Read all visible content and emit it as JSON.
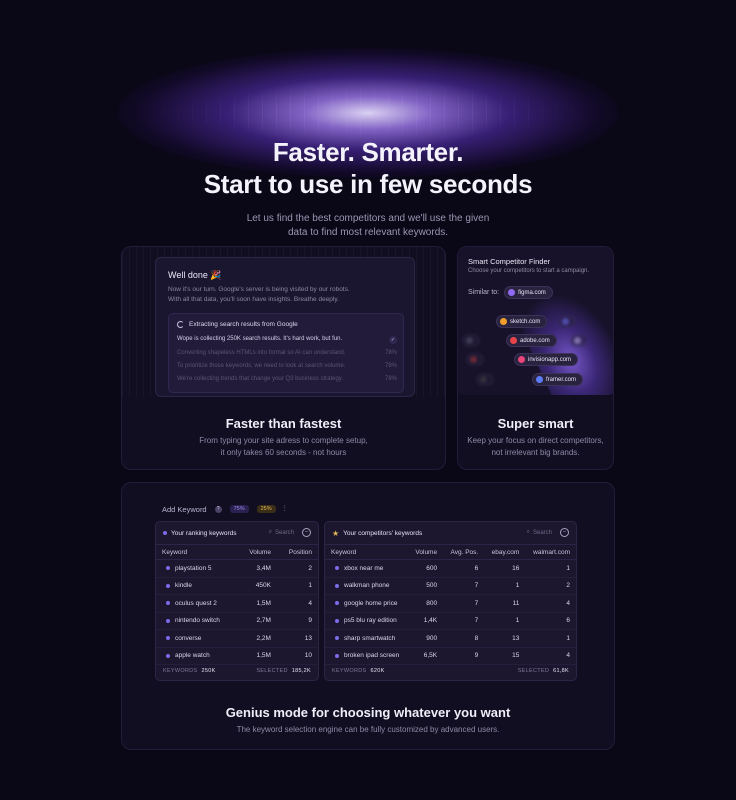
{
  "hero": {
    "title_line1": "Faster. Smarter.",
    "title_line2": "Start to use in few seconds",
    "subtitle_line1": "Let us find the best competitors and we'll use the given",
    "subtitle_line2": "data to find most relevant keywords."
  },
  "fast_card": {
    "title": "Faster than fastest",
    "desc_line1": "From typing your site adress to complete setup,",
    "desc_line2": "it only takes 60 seconds - not hours",
    "panel": {
      "heading": "Well done 🎉",
      "sub_line1": "Now it's our turn. Google's server is being visited by our robots.",
      "sub_line2": "With all that data, you'll soon have insights. Breathe deeply.",
      "task_title": "Extracting search results from Google",
      "tasks": [
        {
          "text": "Wope is collecting 250K search results. It's hard work, but fun.",
          "status": "✓"
        },
        {
          "text": "Converting shapeless HTMLs into format so AI can understand.",
          "status": "78%"
        },
        {
          "text": "To prioritize those keywords, we need to look at search volume.",
          "status": "78%"
        },
        {
          "text": "We're collecting trends that change your Q3 business strategy.",
          "status": "78%"
        }
      ]
    }
  },
  "smart_card": {
    "title": "Super smart",
    "desc_line1": "Keep your focus on direct competitors,",
    "desc_line2": "not irrelevant big brands.",
    "panel": {
      "heading": "Smart Competitor Finder",
      "sub": "Choose your competitors to start a campaign.",
      "similar_label": "Similar to:",
      "similar_value": "figma.com",
      "competitors": [
        "sketch.com",
        "adobe.com",
        "invisionapp.com",
        "framer.com"
      ],
      "colors": {
        "figma": "#8f6bf5",
        "sketch": "#f0a02a",
        "adobe": "#e8454a",
        "invision": "#e8457a",
        "framer": "#5b7cf5"
      }
    }
  },
  "genius_card": {
    "title": "Genius mode for choosing whatever you want",
    "desc": "The keyword selection engine can be fully customized by advanced users.",
    "toolbar": {
      "label": "Add Keyword",
      "tag1": "75%",
      "tag2": "25%"
    },
    "left_panel": {
      "title": "Your ranking keywords",
      "search_placeholder": "Search",
      "columns": [
        "Keyword",
        "Volume",
        "Position"
      ],
      "rows": [
        [
          "playstation 5",
          "3,4M",
          "2"
        ],
        [
          "kindle",
          "450K",
          "1"
        ],
        [
          "oculus quest 2",
          "1,5M",
          "4"
        ],
        [
          "nintendo switch",
          "2,7M",
          "9"
        ],
        [
          "converse",
          "2,2M",
          "13"
        ],
        [
          "apple watch",
          "1,5M",
          "10"
        ]
      ],
      "footer_keywords_label": "KEYWORDS",
      "footer_keywords_value": "250K",
      "footer_selected_label": "SELECTED",
      "footer_selected_value": "185,2K"
    },
    "right_panel": {
      "title": "Your competitors' keywords",
      "search_placeholder": "Search",
      "columns": [
        "Keyword",
        "Volume",
        "Avg. Pos.",
        "ebay.com",
        "walmart.com"
      ],
      "rows": [
        [
          "xbox near me",
          "600",
          "6",
          "16",
          "1"
        ],
        [
          "walkman phone",
          "500",
          "7",
          "1",
          "2"
        ],
        [
          "google home price",
          "800",
          "7",
          "11",
          "4"
        ],
        [
          "ps5 blu ray edition",
          "1,4K",
          "7",
          "1",
          "6"
        ],
        [
          "sharp smartwatch",
          "900",
          "8",
          "13",
          "1"
        ],
        [
          "broken ipad screen",
          "6,5K",
          "9",
          "15",
          "4"
        ]
      ],
      "footer_keywords_label": "KEYWORDS",
      "footer_keywords_value": "620K",
      "footer_selected_label": "SELECTED",
      "footer_selected_value": "61,8K"
    }
  }
}
